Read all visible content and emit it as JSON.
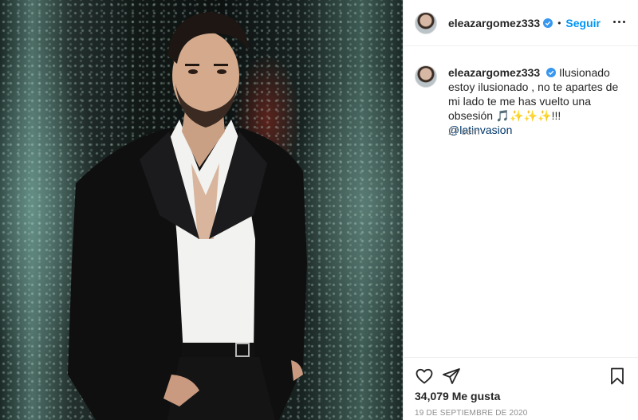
{
  "post": {
    "image_alt": "Man in black suit with open white shirt, hand in pocket, standing before a glittering background",
    "username": "eleazargomez333",
    "verified": true,
    "separator": "•",
    "follow_label": "Seguir",
    "caption_text": "Ilusionado estoy ilusionado , no te apartes de mi lado te me has vuelto una obsesión 🎵✨✨✨!!!",
    "mention": "@latinvasion",
    "time_ago": "27 sem",
    "likes_count": "34,079",
    "likes_label": "Me gusta",
    "date": "19 DE SEPTIEMBRE DE 2020"
  },
  "colors": {
    "accent": "#0095f6",
    "verified": "#3897f0",
    "text": "#262626",
    "muted": "#8e8e8e",
    "mention": "#00376b"
  },
  "icons": {
    "more": "more-horizontal-icon",
    "like": "heart-outline-icon",
    "share": "paper-plane-icon",
    "save": "bookmark-outline-icon",
    "verified": "verified-badge-icon"
  }
}
